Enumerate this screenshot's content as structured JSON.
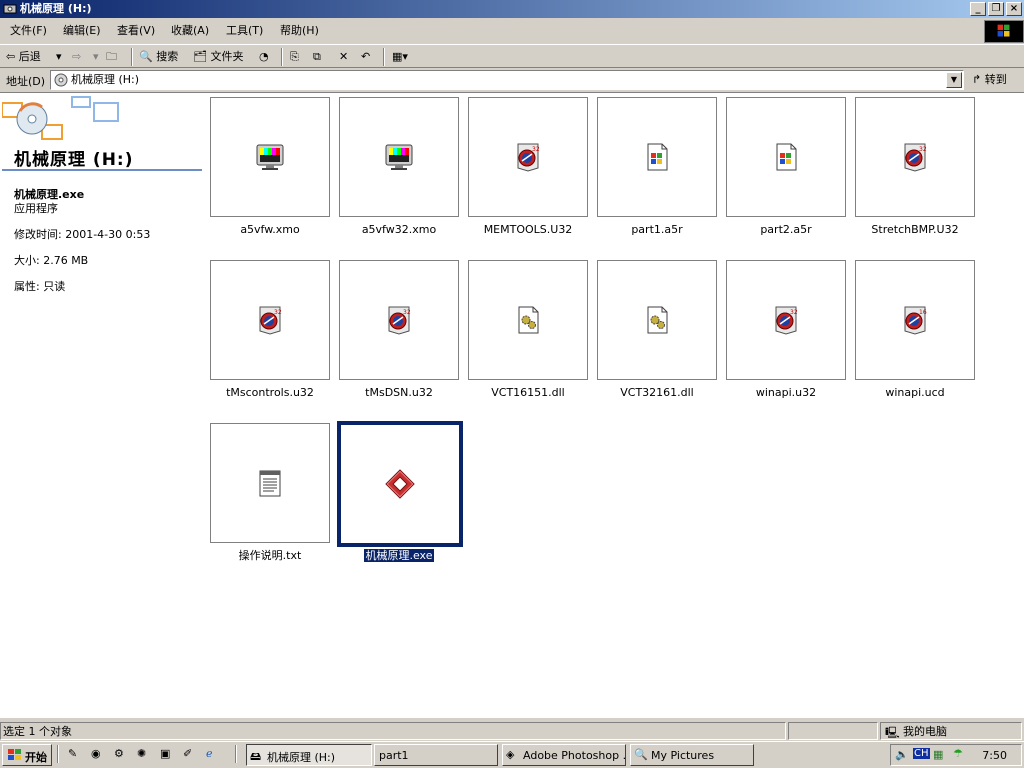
{
  "window": {
    "title": "机械原理 (H:)"
  },
  "menu": [
    "文件(F)",
    "编辑(E)",
    "查看(V)",
    "收藏(A)",
    "工具(T)",
    "帮助(H)"
  ],
  "toolbar": {
    "back": "后退",
    "search": "搜索",
    "folders": "文件夹"
  },
  "address": {
    "label": "地址(D)",
    "value": "机械原理 (H:)",
    "go": "转到"
  },
  "left_panel": {
    "title": "机械原理 (H:)",
    "file_name": "机械原理.exe",
    "file_type": "应用程序",
    "modified": "修改时间: 2001-4-30 0:53",
    "size": "大小: 2.76 MB",
    "attributes": "属性: 只读"
  },
  "files": [
    {
      "name": "a5vfw.xmo",
      "icon": "video-bars-icon"
    },
    {
      "name": "a5vfw32.xmo",
      "icon": "video-bars-icon"
    },
    {
      "name": "MEMTOOLS.U32",
      "icon": "xtra-32-icon"
    },
    {
      "name": "part1.a5r",
      "icon": "windows-file-icon"
    },
    {
      "name": "part2.a5r",
      "icon": "windows-file-icon"
    },
    {
      "name": "StretchBMP.U32",
      "icon": "xtra-32-icon"
    },
    {
      "name": "tMscontrols.u32",
      "icon": "xtra-32-icon"
    },
    {
      "name": "tMsDSN.u32",
      "icon": "xtra-32-icon"
    },
    {
      "name": "VCT16151.dll",
      "icon": "dll-gear-icon"
    },
    {
      "name": "VCT32161.dll",
      "icon": "dll-gear-icon"
    },
    {
      "name": "winapi.u32",
      "icon": "xtra-32-icon"
    },
    {
      "name": "winapi.ucd",
      "icon": "xtra-16-icon"
    },
    {
      "name": "操作说明.txt",
      "icon": "notepad-icon"
    },
    {
      "name": "机械原理.exe",
      "icon": "exe-diamond-icon",
      "selected": true
    }
  ],
  "status": {
    "left": "选定 1 个对象",
    "right": "我的电脑"
  },
  "taskbar": {
    "start": "开始",
    "tasks": [
      "机械原理 (H:)",
      "part1",
      "Adobe Photoshop ...",
      "My Pictures"
    ],
    "tray_lang": "CH",
    "clock": "7:50"
  }
}
